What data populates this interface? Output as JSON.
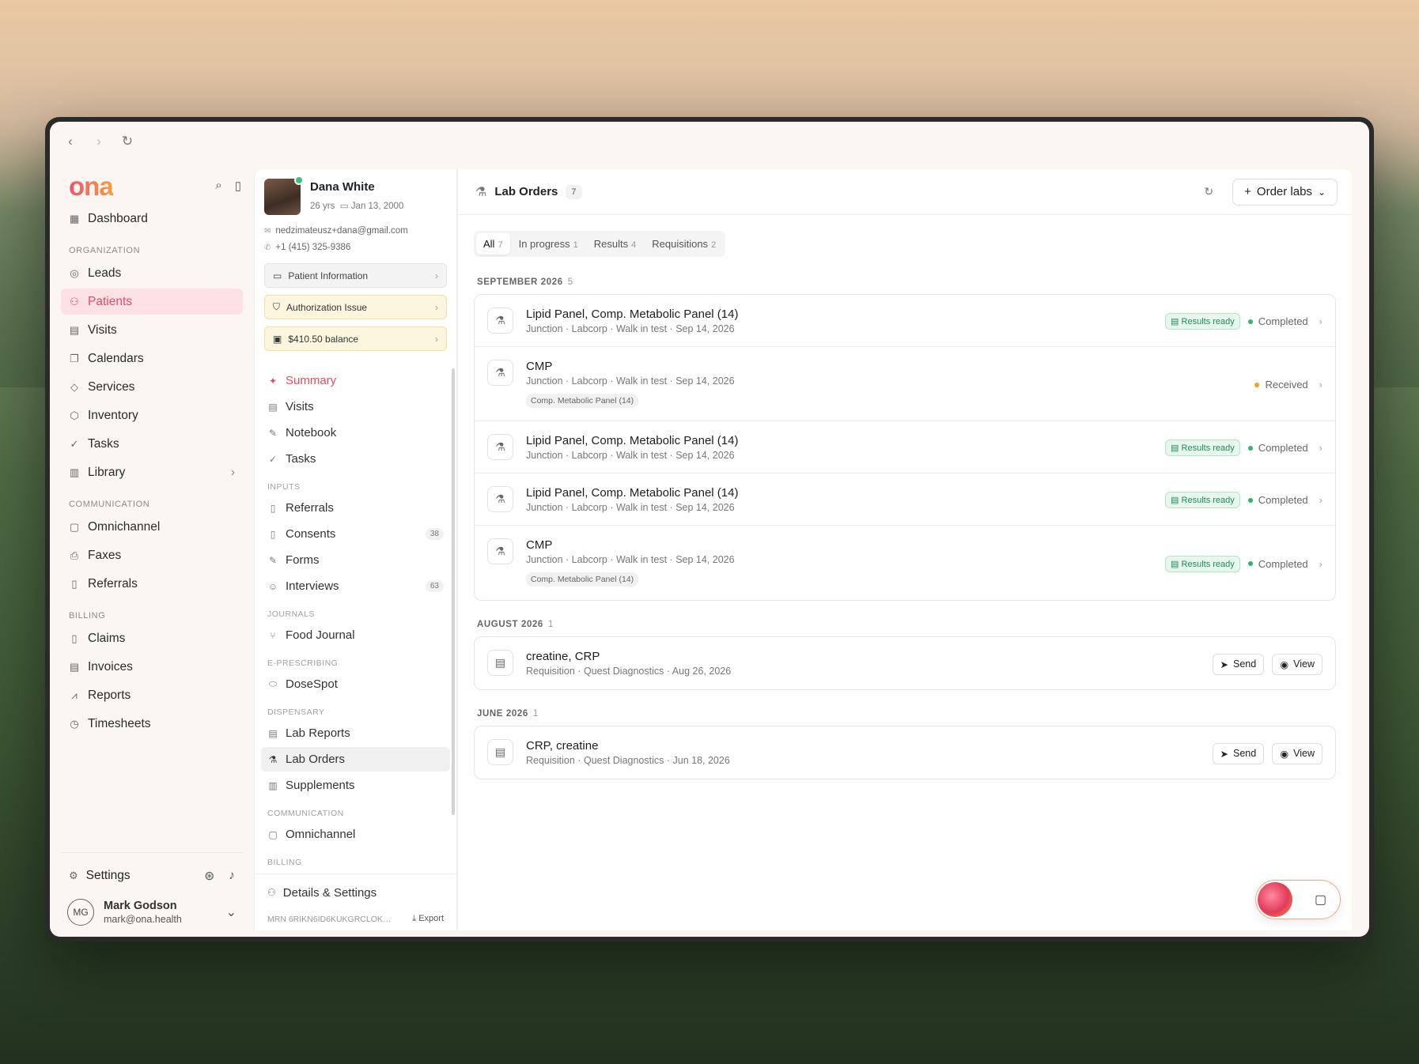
{
  "browser": {
    "back": "‹",
    "forward": "›",
    "reload": "↻"
  },
  "nav": {
    "logo": "ona",
    "dashboard": "Dashboard",
    "sec_org": "ORGANIZATION",
    "org": [
      "Leads",
      "Patients",
      "Visits",
      "Calendars",
      "Services",
      "Inventory",
      "Tasks",
      "Library"
    ],
    "sec_comm": "COMMUNICATION",
    "comm": [
      "Omnichannel",
      "Faxes",
      "Referrals"
    ],
    "sec_billing": "BILLING",
    "billing": [
      "Claims",
      "Invoices",
      "Reports",
      "Timesheets"
    ],
    "settings": "Settings",
    "user": {
      "initials": "MG",
      "name": "Mark Godson",
      "email": "mark@ona.health"
    }
  },
  "patient": {
    "name": "Dana White",
    "age": "26 yrs",
    "dob": "Jan 13, 2000",
    "email": "nedzimateusz+dana@gmail.com",
    "phone": "+1 (415) 325-9386",
    "info_btn": "Patient Information",
    "auth_btn": "Authorization Issue",
    "balance_btn": "$410.50 balance",
    "menu": {
      "summary": "Summary",
      "visits": "Visits",
      "notebook": "Notebook",
      "tasks": "Tasks",
      "sec_inputs": "INPUTS",
      "referrals": "Referrals",
      "consents": "Consents",
      "consents_count": "38",
      "forms": "Forms",
      "interviews": "Interviews",
      "interviews_count": "63",
      "sec_journals": "JOURNALS",
      "food": "Food Journal",
      "sec_erx": "E-PRESCRIBING",
      "dosespot": "DoseSpot",
      "sec_disp": "DISPENSARY",
      "lab_reports": "Lab Reports",
      "lab_orders": "Lab Orders",
      "supplements": "Supplements",
      "sec_comm": "COMMUNICATION",
      "omni": "Omnichannel",
      "sec_billing": "BILLING"
    },
    "details": "Details & Settings",
    "mrn": "MRN 6RIKN6ID6KUKGRCLOK…",
    "export": "Export"
  },
  "main": {
    "title": "Lab Orders",
    "count": "7",
    "order_btn": "Order labs",
    "tabs": [
      {
        "label": "All",
        "n": "7"
      },
      {
        "label": "In progress",
        "n": "1"
      },
      {
        "label": "Results",
        "n": "4"
      },
      {
        "label": "Requisitions",
        "n": "2"
      }
    ],
    "groups": [
      {
        "label": "SEPTEMBER 2026",
        "n": "5"
      },
      {
        "label": "AUGUST 2026",
        "n": "1"
      },
      {
        "label": "JUNE 2026",
        "n": "1"
      }
    ],
    "sep": [
      {
        "title": "Lipid Panel, Comp. Metabolic Panel (14)",
        "sub": "Junction · Labcorp · Walk in test · Sep 14, 2026",
        "ready": "Results ready",
        "status": "Completed"
      },
      {
        "title": "CMP",
        "sub": "Junction · Labcorp · Walk in test · Sep 14, 2026",
        "chip": "Comp. Metabolic Panel (14)",
        "status": "Received"
      },
      {
        "title": "Lipid Panel, Comp. Metabolic Panel (14)",
        "sub": "Junction · Labcorp · Walk in test · Sep 14, 2026",
        "ready": "Results ready",
        "status": "Completed"
      },
      {
        "title": "Lipid Panel, Comp. Metabolic Panel (14)",
        "sub": "Junction · Labcorp · Walk in test · Sep 14, 2026",
        "ready": "Results ready",
        "status": "Completed"
      },
      {
        "title": "CMP",
        "sub": "Junction · Labcorp · Walk in test · Sep 14, 2026",
        "chip": "Comp. Metabolic Panel (14)",
        "ready": "Results ready",
        "status": "Completed"
      }
    ],
    "aug": {
      "title": "creatine, CRP",
      "sub": "Requisition · Quest Diagnostics · Aug 26, 2026",
      "send": "Send",
      "view": "View"
    },
    "jun": {
      "title": "CRP, creatine",
      "sub": "Requisition · Quest Diagnostics · Jun 18, 2026",
      "send": "Send",
      "view": "View"
    }
  },
  "colors": {
    "accent": "#e14b66",
    "completed": "#2bb673",
    "received": "#f0a020"
  }
}
